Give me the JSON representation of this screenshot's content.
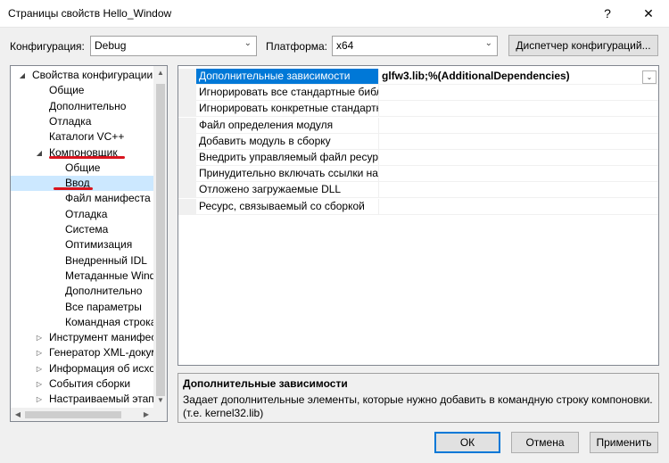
{
  "window": {
    "title": "Страницы свойств Hello_Window",
    "help": "?",
    "close": "✕"
  },
  "toolbar": {
    "config_label": "Конфигурация:",
    "config_value": "Debug",
    "platform_label": "Платформа:",
    "platform_value": "x64",
    "config_manager": "Диспетчер конфигураций..."
  },
  "tree": {
    "items": [
      {
        "label": "Свойства конфигурации",
        "expander": "◢"
      },
      {
        "label": "Общие"
      },
      {
        "label": "Дополнительно"
      },
      {
        "label": "Отладка"
      },
      {
        "label": "Каталоги VC++"
      },
      {
        "label": "Компоновщик",
        "expander": "◢"
      },
      {
        "label": "Общие"
      },
      {
        "label": "Ввод"
      },
      {
        "label": "Файл манифеста"
      },
      {
        "label": "Отладка"
      },
      {
        "label": "Система"
      },
      {
        "label": "Оптимизация"
      },
      {
        "label": "Внедренный IDL"
      },
      {
        "label": "Метаданные Windows"
      },
      {
        "label": "Дополнительно"
      },
      {
        "label": "Все параметры"
      },
      {
        "label": "Командная строка"
      },
      {
        "label": "Инструмент манифеста",
        "expander": "▷"
      },
      {
        "label": "Генератор XML-документов",
        "expander": "▷"
      },
      {
        "label": "Информация об исходном коде",
        "expander": "▷"
      },
      {
        "label": "События сборки",
        "expander": "▷"
      },
      {
        "label": "Настраиваемый этап сборки",
        "expander": "▷"
      }
    ]
  },
  "grid": {
    "rows": [
      {
        "name": "Дополнительные зависимости",
        "value": "glfw3.lib;%(AdditionalDependencies)"
      },
      {
        "name": "Игнорировать все стандартные библиотеки",
        "value": ""
      },
      {
        "name": "Игнорировать конкретные стандартные библиотеки",
        "value": ""
      },
      {
        "name": "Файл определения модуля",
        "value": ""
      },
      {
        "name": "Добавить модуль в сборку",
        "value": ""
      },
      {
        "name": "Внедрить управляемый файл ресурсов",
        "value": ""
      },
      {
        "name": "Принудительно включать ссылки на символы",
        "value": ""
      },
      {
        "name": "Отложено загружаемые DLL",
        "value": ""
      },
      {
        "name": "Ресурс, связываемый со сборкой",
        "value": ""
      }
    ]
  },
  "description": {
    "title": "Дополнительные зависимости",
    "text": "Задает дополнительные элементы, которые нужно добавить в командную строку компоновки. (т.е. kernel32.lib)"
  },
  "buttons": {
    "ok": "ОК",
    "cancel": "Отмена",
    "apply": "Применить"
  },
  "colors": {
    "accent": "#0078d7",
    "selection": "#cce8ff",
    "annotation": "#d9141e"
  }
}
